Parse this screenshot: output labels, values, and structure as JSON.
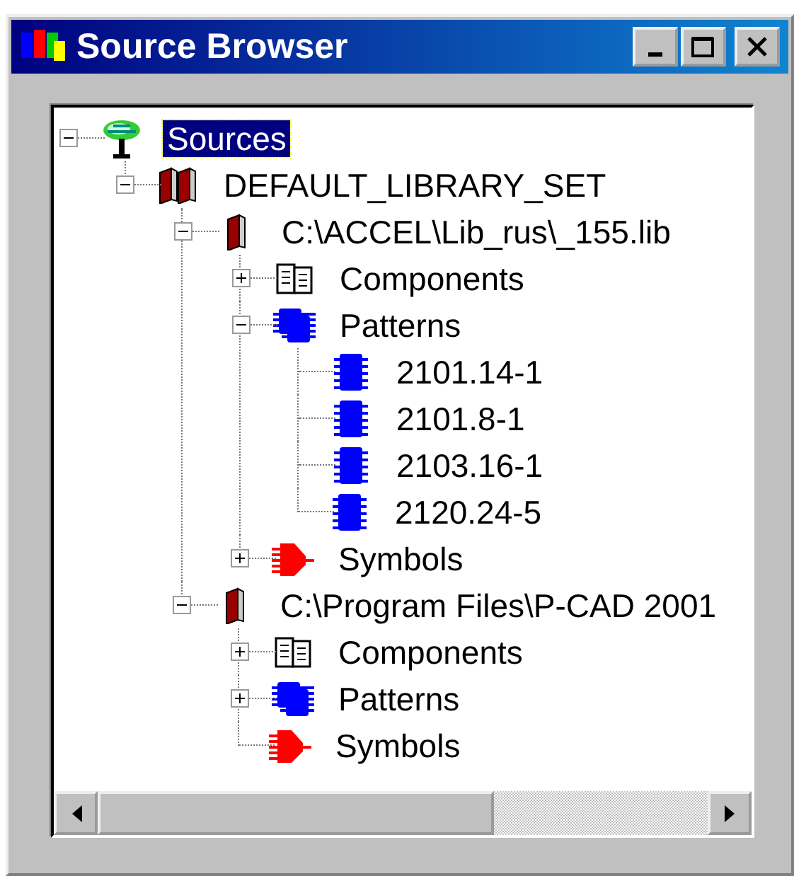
{
  "window": {
    "title": "Source Browser"
  },
  "tree": {
    "nodes": [
      {
        "label": "Sources",
        "kind": "root",
        "expanded": true,
        "selected": true,
        "children": [
          {
            "label": "DEFAULT_LIBRARY_SET",
            "kind": "library-set",
            "expanded": true,
            "selected": false,
            "children": [
              {
                "label": "C:\\ACCEL\\Lib_rus\\_155.lib",
                "kind": "library",
                "expanded": true,
                "selected": false,
                "children": [
                  {
                    "label": "Components",
                    "kind": "components",
                    "expanded": false,
                    "selected": false
                  },
                  {
                    "label": "Patterns",
                    "kind": "patterns",
                    "expanded": true,
                    "selected": false,
                    "children": [
                      {
                        "label": "2101.14-1",
                        "kind": "pattern",
                        "selected": false
                      },
                      {
                        "label": "2101.8-1",
                        "kind": "pattern",
                        "selected": false
                      },
                      {
                        "label": "2103.16-1",
                        "kind": "pattern",
                        "selected": false
                      },
                      {
                        "label": "2120.24-5",
                        "kind": "pattern",
                        "selected": false
                      }
                    ]
                  },
                  {
                    "label": "Symbols",
                    "kind": "symbols",
                    "expanded": false,
                    "selected": false
                  }
                ]
              },
              {
                "label": "C:\\Program Files\\P-CAD 2001",
                "kind": "library",
                "expanded": true,
                "selected": false,
                "children": [
                  {
                    "label": "Components",
                    "kind": "components",
                    "expanded": false,
                    "selected": false
                  },
                  {
                    "label": "Patterns",
                    "kind": "patterns",
                    "expanded": false,
                    "selected": false
                  },
                  {
                    "label": "Symbols",
                    "kind": "symbols",
                    "selected": false
                  }
                ]
              }
            ]
          }
        ]
      }
    ]
  }
}
